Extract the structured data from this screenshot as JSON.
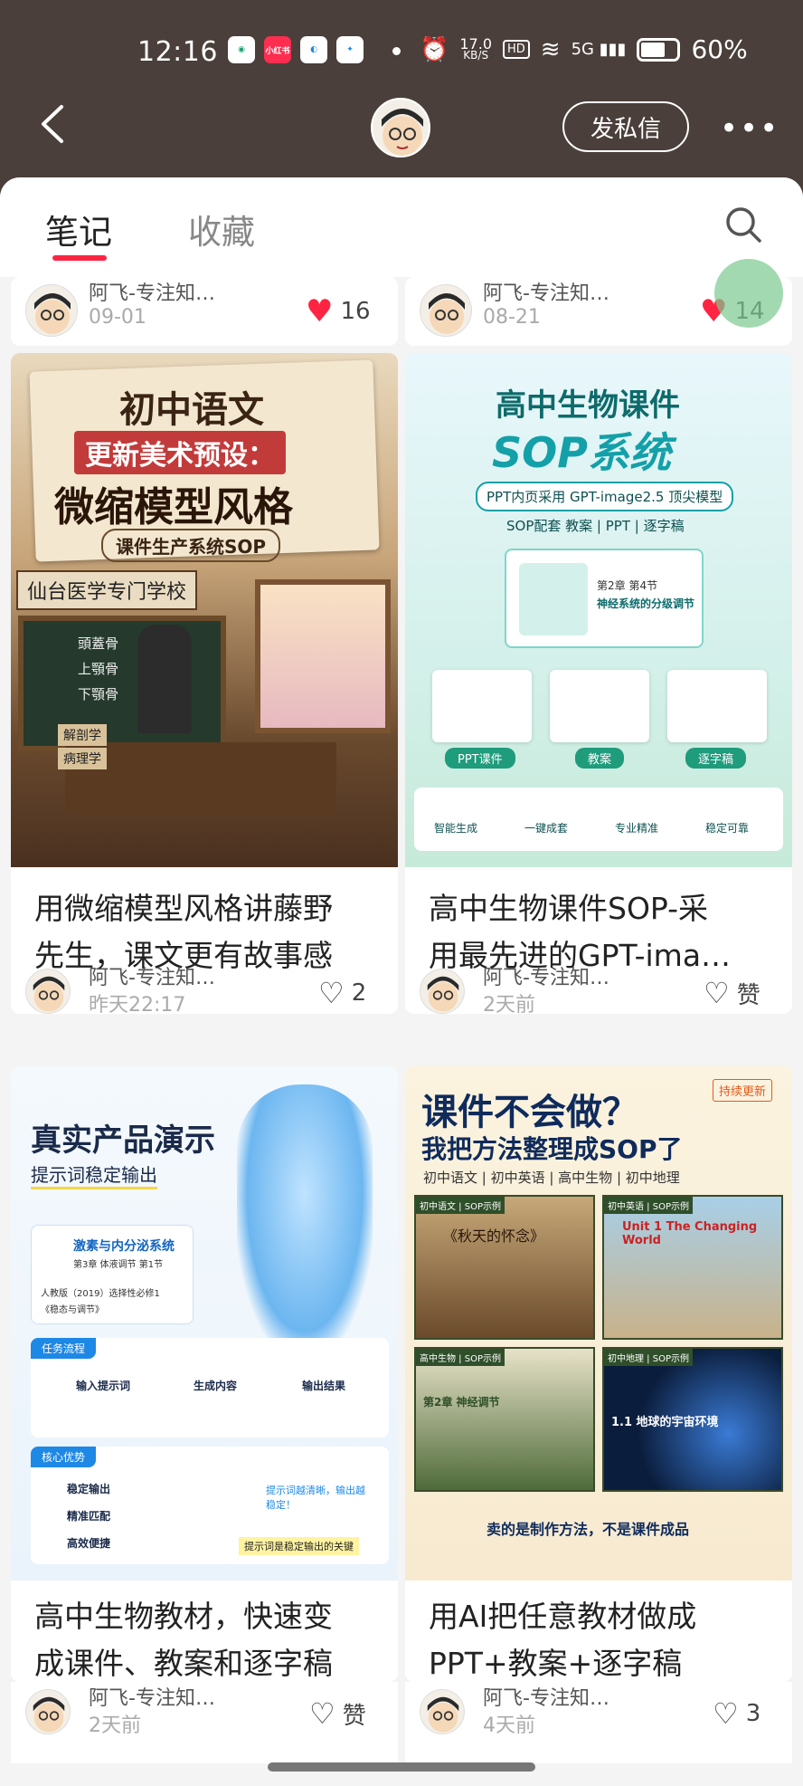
{
  "status": {
    "time": "12:16",
    "net_speed": "17.0",
    "net_unit": "KB/S",
    "hd": "HD",
    "signal": "5G",
    "battery": "60%"
  },
  "header": {
    "dm_label": "发私信"
  },
  "tabs": {
    "notes": "笔记",
    "favorites": "收藏"
  },
  "top_row": [
    {
      "author": "阿飞-专注知…",
      "date": "09-01",
      "likes": "16"
    },
    {
      "author": "阿飞-专注知…",
      "date": "08-21",
      "likes": "14"
    }
  ],
  "cards": [
    {
      "title": "用微缩模型风格讲藤野先生，课文更有故事感",
      "title_line1": "用微缩模型风格讲藤野",
      "title_line2": "先生，课文更有故事感",
      "author": "阿飞-专注知…",
      "date": "昨天22:17",
      "likes": "2",
      "cover": {
        "h1": "初中语文",
        "h2": "更新美术预设：",
        "h3": "微缩模型风格",
        "h4": "课件生产系统SOP",
        "sign": "仙台医学专门学校",
        "book1": "解剖学",
        "book2": "病理学",
        "board1": "頭蓋骨",
        "board2": "上顎骨",
        "board3": "下顎骨"
      }
    },
    {
      "title": "高中生物课件SOP-采用最先进的GPT-ima…",
      "title_line1": "高中生物课件SOP-采",
      "title_line2": "用最先进的GPT-ima…",
      "author": "阿飞-专注知…",
      "date": "2天前",
      "likes": "赞",
      "cover": {
        "h1": "高中生物课件",
        "h2": "SOP系统",
        "sub": "PPT内页采用 GPT-image2.5 顶尖模型",
        "tags": "SOP配套 教案 | PPT | 逐字稿",
        "chapter": "第2章 第4节",
        "chapter_title": "神经系统的分级调节",
        "b1": "PPT课件",
        "b2": "教案",
        "b3": "逐字稿",
        "f1": "智能生成",
        "f2": "一键成套",
        "f3": "专业精准",
        "f4": "稳定可靠"
      }
    },
    {
      "title": "高中生物教材，快速变成课件、教案和逐字稿",
      "title_line1": "高中生物教材，快速变",
      "title_line2": "成课件、教案和逐字稿",
      "author": "阿飞-专注知…",
      "date": "2天前",
      "likes": "赞",
      "cover": {
        "h1": "真实产品演示",
        "h2": "提示词稳定输出",
        "box_title": "激素与内分泌系统",
        "box_sub": "第3章 体液调节 第1节",
        "box_book": "人教版（2019）选择性必修1",
        "box_book2": "《稳态与调节》",
        "flow": "任务流程",
        "s1": "输入提示词",
        "s2": "生成内容",
        "s3": "输出结果",
        "adv": "核心优势",
        "a1": "稳定输出",
        "a2": "精准匹配",
        "a3": "高效便捷",
        "note": "提示词越清晰，输出越稳定！",
        "key": "提示词是稳定输出的关键"
      }
    },
    {
      "title": "用AI把任意教材做成PPT+教案+逐字稿",
      "title_line1": "用AI把任意教材做成",
      "title_line2": "PPT+教案+逐字稿",
      "author": "阿飞-专注知…",
      "date": "4天前",
      "likes": "3",
      "cover": {
        "badge": "持续更新",
        "h1": "课件不会做？",
        "h2": "我把方法整理成SOP了",
        "subjects": "初中语文 | 初中英语 | 高中生物 | 初中地理",
        "p1": "初中语文 | SOP示例",
        "p1t": "《秋天的怀念》",
        "p2": "初中英语 | SOP示例",
        "p2t": "Unit 1 The Changing World",
        "p3": "高中生物 | SOP示例",
        "p3t": "第2章 神经调节",
        "p4": "初中地理 | SOP示例",
        "p4t": "1.1 地球的宇宙环境",
        "footer": "卖的是制作方法，不是课件成品"
      }
    }
  ],
  "colors": {
    "accent": "#ff2442",
    "header_bg": "#4a3f3a"
  }
}
